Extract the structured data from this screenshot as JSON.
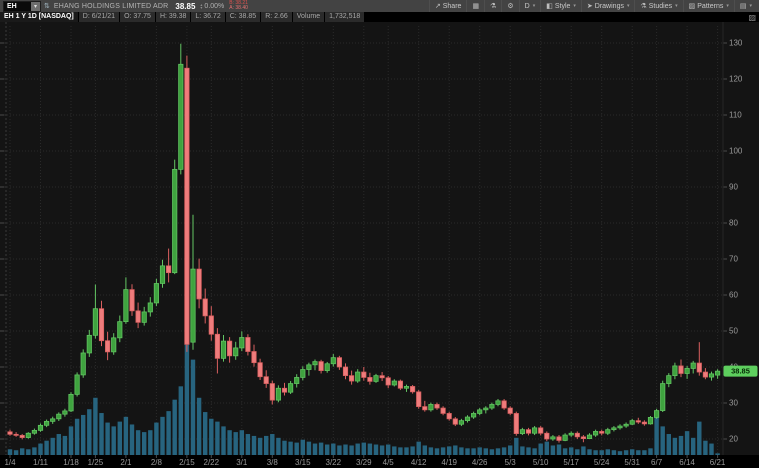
{
  "toolbar": {
    "symbol": "EH",
    "company": "EHANG HOLDINGS LIMITED ADR",
    "last_price": "38.85",
    "change_pct": "0.00%",
    "bid": "B: 38.21",
    "ask": "A: 38.40",
    "buttons": [
      {
        "icon": "share-icon",
        "label": "Share",
        "caret": false
      },
      {
        "icon": "layout-icon",
        "label": "",
        "caret": false
      },
      {
        "icon": "flask-icon",
        "label": "",
        "caret": false
      },
      {
        "icon": "gear-icon",
        "label": "",
        "caret": false
      },
      {
        "icon": "",
        "label": "D",
        "caret": true
      },
      {
        "icon": "style-icon",
        "label": "Style",
        "caret": true
      },
      {
        "icon": "cursor-icon",
        "label": "Drawings",
        "caret": true
      },
      {
        "icon": "flask-icon",
        "label": "Studies",
        "caret": true
      },
      {
        "icon": "patterns-icon",
        "label": "Patterns",
        "caret": true
      },
      {
        "icon": "trash-icon",
        "label": "",
        "caret": true
      }
    ]
  },
  "status_bar": {
    "title": "EH 1 Y 1D [NASDAQ]",
    "fields": [
      "D: 6/21/21",
      "O: 37.75",
      "H: 39.38",
      "L: 36.72",
      "C: 38.85",
      "R: 2.66",
      "Volume",
      "1,732,518"
    ]
  },
  "colors": {
    "chart_bg": "#141414",
    "grid": "#2a2a2a",
    "axis_text": "#9a9a9a",
    "tick": "#4a4a4a",
    "up_fill": "#3fa33f",
    "up_stroke": "#63c663",
    "down_fill": "#ef7c7c",
    "down_stroke": "#d95f5f",
    "volume": "#27647f",
    "price_bubble": "#5ecf5e",
    "bubble_text": "#062806"
  },
  "chart_data": {
    "type": "candlestick",
    "symbol": "EH",
    "timeframe": "1 Y 1D",
    "exchange": "NASDAQ",
    "ylim": [
      14,
      136
    ],
    "y_ticks": [
      20,
      30,
      40,
      50,
      60,
      70,
      80,
      90,
      100,
      110,
      120,
      130
    ],
    "last_price": 38.85,
    "last_price_label": "38.85",
    "volume_max": 130,
    "x_labels": [
      {
        "label": "1/4",
        "index": 0
      },
      {
        "label": "1/11",
        "index": 5
      },
      {
        "label": "1/18",
        "index": 10
      },
      {
        "label": "1/25",
        "index": 14
      },
      {
        "label": "2/1",
        "index": 19
      },
      {
        "label": "2/8",
        "index": 24
      },
      {
        "label": "2/15",
        "index": 29
      },
      {
        "label": "2/22",
        "index": 33
      },
      {
        "label": "3/1",
        "index": 38
      },
      {
        "label": "3/8",
        "index": 43
      },
      {
        "label": "3/15",
        "index": 48
      },
      {
        "label": "3/22",
        "index": 53
      },
      {
        "label": "3/29",
        "index": 58
      },
      {
        "label": "4/5",
        "index": 62
      },
      {
        "label": "4/12",
        "index": 67
      },
      {
        "label": "4/19",
        "index": 72
      },
      {
        "label": "4/26",
        "index": 77
      },
      {
        "label": "5/3",
        "index": 82
      },
      {
        "label": "5/10",
        "index": 87
      },
      {
        "label": "5/17",
        "index": 92
      },
      {
        "label": "5/24",
        "index": 97
      },
      {
        "label": "5/31",
        "index": 102
      },
      {
        "label": "6/7",
        "index": 106
      },
      {
        "label": "6/14",
        "index": 111
      },
      {
        "label": "6/21",
        "index": 116
      }
    ],
    "candles": [
      [
        "1/4",
        22.0,
        22.6,
        20.9,
        21.3,
        6
      ],
      [
        "1/5",
        21.3,
        21.9,
        20.6,
        21.0,
        5
      ],
      [
        "1/6",
        21.0,
        21.4,
        19.9,
        20.4,
        7
      ],
      [
        "1/7",
        20.4,
        21.9,
        20.1,
        21.6,
        6
      ],
      [
        "1/8",
        21.6,
        22.9,
        21.2,
        22.4,
        8
      ],
      [
        "1/11",
        22.4,
        24.3,
        22.0,
        23.8,
        12
      ],
      [
        "1/12",
        23.8,
        25.4,
        23.3,
        24.9,
        15
      ],
      [
        "1/13",
        24.9,
        26.2,
        24.2,
        25.6,
        18
      ],
      [
        "1/14",
        25.6,
        27.4,
        25.0,
        26.9,
        22
      ],
      [
        "1/15",
        26.9,
        28.4,
        26.2,
        27.8,
        20
      ],
      [
        "1/19",
        27.8,
        33.0,
        27.5,
        32.4,
        30
      ],
      [
        "1/20",
        32.4,
        38.5,
        31.8,
        37.8,
        38
      ],
      [
        "1/21",
        37.8,
        44.9,
        37.0,
        43.9,
        42
      ],
      [
        "1/22",
        43.9,
        50.3,
        42.8,
        48.8,
        48
      ],
      [
        "1/25",
        48.8,
        62.9,
        47.9,
        56.2,
        60
      ],
      [
        "1/26",
        56.2,
        58.4,
        45.8,
        47.3,
        44
      ],
      [
        "1/27",
        47.3,
        49.8,
        41.9,
        44.2,
        34
      ],
      [
        "1/28",
        44.2,
        49.4,
        43.4,
        48.1,
        30
      ],
      [
        "1/29",
        48.1,
        54.3,
        46.9,
        52.6,
        35
      ],
      [
        "2/1",
        52.6,
        64.9,
        52.0,
        61.5,
        40
      ],
      [
        "2/2",
        61.5,
        63.0,
        54.2,
        55.6,
        32
      ],
      [
        "2/3",
        55.6,
        57.9,
        50.8,
        52.4,
        26
      ],
      [
        "2/4",
        52.4,
        56.7,
        51.5,
        55.3,
        24
      ],
      [
        "2/5",
        55.3,
        59.4,
        54.0,
        57.8,
        26
      ],
      [
        "2/8",
        57.8,
        64.5,
        56.9,
        63.2,
        34
      ],
      [
        "2/9",
        63.2,
        69.8,
        62.0,
        68.1,
        40
      ],
      [
        "2/10",
        68.1,
        72.9,
        63.5,
        66.2,
        46
      ],
      [
        "2/11",
        66.2,
        97.6,
        65.8,
        94.9,
        58
      ],
      [
        "2/12",
        94.9,
        129.8,
        93.5,
        124.09,
        72
      ],
      [
        "2/16",
        123.0,
        126.5,
        44.2,
        46.3,
        130
      ],
      [
        "2/17",
        46.9,
        82.3,
        44.8,
        67.2,
        100
      ],
      [
        "2/18",
        67.2,
        70.1,
        56.3,
        58.9,
        60
      ],
      [
        "2/19",
        58.9,
        61.8,
        52.1,
        54.2,
        45
      ],
      [
        "2/22",
        54.2,
        56.9,
        47.3,
        49.1,
        38
      ],
      [
        "2/23",
        49.1,
        50.8,
        38.2,
        42.4,
        35
      ],
      [
        "2/24",
        42.4,
        48.9,
        41.5,
        47.2,
        30
      ],
      [
        "2/25",
        47.2,
        48.3,
        41.2,
        43.1,
        26
      ],
      [
        "2/26",
        43.1,
        47.0,
        42.0,
        45.3,
        24
      ],
      [
        "3/1",
        45.3,
        49.9,
        44.4,
        48.2,
        26
      ],
      [
        "3/2",
        48.2,
        49.1,
        43.2,
        44.3,
        22
      ],
      [
        "3/3",
        44.3,
        46.2,
        40.1,
        41.2,
        20
      ],
      [
        "3/4",
        41.2,
        42.3,
        36.4,
        37.3,
        18
      ],
      [
        "3/5",
        37.3,
        39.1,
        34.2,
        35.4,
        20
      ],
      [
        "3/8",
        35.4,
        36.2,
        29.6,
        30.8,
        22
      ],
      [
        "3/9",
        30.8,
        34.9,
        30.2,
        34.1,
        18
      ],
      [
        "3/10",
        34.1,
        35.6,
        32.1,
        33.0,
        15
      ],
      [
        "3/11",
        33.0,
        36.1,
        32.5,
        35.4,
        14
      ],
      [
        "3/12",
        35.4,
        38.0,
        34.3,
        37.1,
        13
      ],
      [
        "3/15",
        37.1,
        40.2,
        36.3,
        39.3,
        16
      ],
      [
        "3/16",
        39.3,
        41.2,
        37.6,
        40.6,
        14
      ],
      [
        "3/17",
        40.6,
        42.1,
        39.1,
        41.5,
        12
      ],
      [
        "3/18",
        41.5,
        42.0,
        38.2,
        39.0,
        13
      ],
      [
        "3/19",
        39.0,
        41.4,
        38.4,
        40.9,
        11
      ],
      [
        "3/22",
        40.9,
        43.6,
        40.1,
        42.6,
        12
      ],
      [
        "3/23",
        42.6,
        43.1,
        39.2,
        40.0,
        10
      ],
      [
        "3/24",
        40.0,
        41.0,
        36.6,
        37.6,
        11
      ],
      [
        "3/25",
        37.6,
        39.0,
        35.1,
        36.1,
        10
      ],
      [
        "3/26",
        36.1,
        39.4,
        35.6,
        38.6,
        12
      ],
      [
        "3/29",
        38.6,
        40.0,
        36.2,
        37.1,
        13
      ],
      [
        "3/30",
        37.1,
        38.4,
        35.1,
        36.0,
        12
      ],
      [
        "3/31",
        36.0,
        38.1,
        35.6,
        37.6,
        11
      ],
      [
        "4/1",
        37.6,
        38.6,
        36.1,
        37.0,
        10
      ],
      [
        "4/5",
        37.0,
        37.5,
        34.1,
        35.0,
        11
      ],
      [
        "4/6",
        35.0,
        36.6,
        34.6,
        36.1,
        9
      ],
      [
        "4/7",
        36.1,
        36.5,
        33.6,
        34.1,
        8
      ],
      [
        "4/8",
        34.1,
        35.1,
        33.1,
        34.6,
        8
      ],
      [
        "4/9",
        34.6,
        35.0,
        32.6,
        33.1,
        9
      ],
      [
        "4/12",
        33.1,
        33.6,
        28.4,
        29.0,
        14
      ],
      [
        "4/13",
        29.0,
        30.6,
        27.6,
        28.1,
        10
      ],
      [
        "4/14",
        28.1,
        30.1,
        27.6,
        29.6,
        8
      ],
      [
        "4/15",
        29.6,
        30.1,
        28.1,
        28.6,
        7
      ],
      [
        "4/16",
        28.6,
        29.1,
        26.6,
        27.1,
        8
      ],
      [
        "4/19",
        27.1,
        27.6,
        25.1,
        25.6,
        9
      ],
      [
        "4/20",
        25.6,
        26.1,
        23.6,
        24.1,
        10
      ],
      [
        "4/21",
        24.1,
        25.6,
        23.6,
        25.1,
        8
      ],
      [
        "4/22",
        25.1,
        26.6,
        24.6,
        26.1,
        7
      ],
      [
        "4/23",
        26.1,
        27.6,
        25.6,
        27.1,
        7
      ],
      [
        "4/26",
        27.1,
        28.6,
        26.6,
        28.1,
        8
      ],
      [
        "4/27",
        28.1,
        29.1,
        27.1,
        28.6,
        7
      ],
      [
        "4/28",
        28.6,
        30.1,
        28.1,
        29.6,
        6
      ],
      [
        "4/29",
        29.6,
        31.1,
        29.1,
        30.6,
        7
      ],
      [
        "4/30",
        30.6,
        31.1,
        28.1,
        28.6,
        8
      ],
      [
        "5/3",
        28.6,
        29.1,
        26.6,
        27.1,
        10
      ],
      [
        "5/4",
        27.1,
        27.6,
        20.9,
        21.5,
        18
      ],
      [
        "5/5",
        21.5,
        23.1,
        21.1,
        22.6,
        9
      ],
      [
        "5/6",
        22.6,
        23.1,
        21.0,
        21.6,
        8
      ],
      [
        "5/7",
        21.6,
        23.6,
        21.1,
        23.1,
        7
      ],
      [
        "5/10",
        23.1,
        23.6,
        21.0,
        21.6,
        12
      ],
      [
        "5/11",
        21.6,
        22.1,
        19.4,
        20.0,
        14
      ],
      [
        "5/12",
        20.0,
        21.1,
        19.5,
        20.6,
        10
      ],
      [
        "5/13",
        20.6,
        21.1,
        19.0,
        19.6,
        11
      ],
      [
        "5/14",
        19.6,
        21.6,
        19.4,
        21.1,
        7
      ],
      [
        "5/17",
        21.1,
        22.1,
        20.6,
        21.6,
        8
      ],
      [
        "5/18",
        21.6,
        22.1,
        20.0,
        20.6,
        6
      ],
      [
        "5/19",
        20.6,
        21.1,
        19.1,
        20.1,
        9
      ],
      [
        "5/20",
        20.1,
        21.6,
        20.0,
        21.1,
        6
      ],
      [
        "5/21",
        21.1,
        22.6,
        20.6,
        22.1,
        5
      ],
      [
        "5/24",
        22.1,
        22.6,
        21.0,
        21.6,
        5
      ],
      [
        "5/25",
        21.6,
        23.1,
        21.1,
        22.6,
        6
      ],
      [
        "5/26",
        22.6,
        23.6,
        22.1,
        23.1,
        5
      ],
      [
        "5/27",
        23.1,
        24.1,
        22.6,
        23.6,
        4
      ],
      [
        "5/28",
        23.6,
        24.6,
        23.1,
        24.1,
        5
      ],
      [
        "6/1",
        24.1,
        25.6,
        23.9,
        25.1,
        6
      ],
      [
        "6/2",
        25.1,
        25.9,
        24.2,
        24.7,
        5
      ],
      [
        "6/3",
        24.7,
        25.2,
        23.7,
        24.2,
        5
      ],
      [
        "6/4",
        24.2,
        26.4,
        24.0,
        26.0,
        7
      ],
      [
        "6/7",
        26.0,
        28.4,
        25.6,
        27.9,
        40
      ],
      [
        "6/8",
        27.9,
        36.2,
        27.5,
        35.4,
        30
      ],
      [
        "6/9",
        35.4,
        38.3,
        34.4,
        37.6,
        22
      ],
      [
        "6/10",
        37.6,
        41.2,
        36.6,
        40.3,
        18
      ],
      [
        "6/11",
        40.3,
        42.1,
        37.2,
        38.2,
        20
      ],
      [
        "6/14",
        38.2,
        40.3,
        36.7,
        39.6,
        25
      ],
      [
        "6/15",
        39.6,
        41.7,
        38.2,
        41.1,
        18
      ],
      [
        "6/16",
        41.1,
        46.9,
        37.6,
        38.6,
        35
      ],
      [
        "6/17",
        38.6,
        39.7,
        36.6,
        37.2,
        15
      ],
      [
        "6/18",
        37.2,
        38.7,
        36.2,
        38.1,
        12
      ],
      [
        "6/21",
        37.75,
        39.38,
        36.72,
        38.85,
        1.73
      ]
    ]
  }
}
